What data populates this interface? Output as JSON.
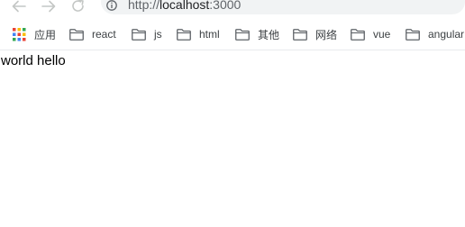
{
  "address_bar": {
    "scheme": "http://",
    "host": "localhost",
    "port": ":3000"
  },
  "bookmarks": [
    {
      "label": "应用",
      "icon": "apps-grid-icon"
    },
    {
      "label": "react",
      "icon": "folder-icon"
    },
    {
      "label": "js",
      "icon": "folder-icon"
    },
    {
      "label": "html",
      "icon": "folder-icon"
    },
    {
      "label": "其他",
      "icon": "folder-icon"
    },
    {
      "label": "网络",
      "icon": "folder-icon"
    },
    {
      "label": "vue",
      "icon": "folder-icon"
    },
    {
      "label": "angular",
      "icon": "folder-icon"
    }
  ],
  "page": {
    "text": "world hello"
  },
  "icons": {
    "back": "arrow-left-icon",
    "forward": "arrow-right-icon",
    "reload": "reload-icon",
    "site_info": "info-icon"
  }
}
